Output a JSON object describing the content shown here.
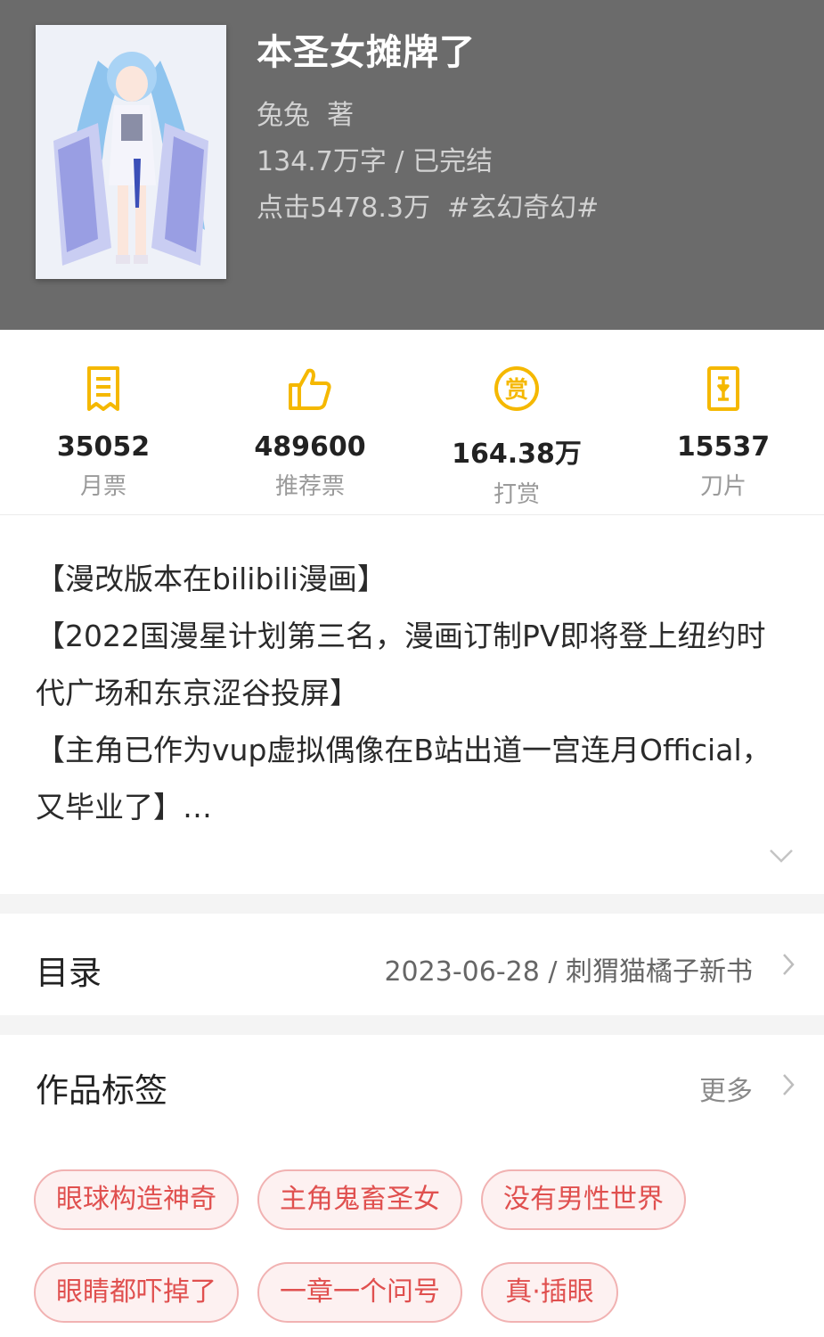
{
  "book": {
    "title": "本圣女摊牌了",
    "author_line": "兔兔  著",
    "words_line": "134.7万字 / 已完结",
    "clicks_line": "点击5478.3万  #玄幻奇幻#"
  },
  "stats": [
    {
      "icon": "monthly-ticket-icon",
      "value": "35052",
      "label": "月票"
    },
    {
      "icon": "thumbs-up-icon",
      "value": "489600",
      "label": "推荐票"
    },
    {
      "icon": "reward-coin-icon",
      "value": "164.38万",
      "label": "打赏"
    },
    {
      "icon": "blade-icon",
      "value": "15537",
      "label": "刀片"
    }
  ],
  "description": {
    "lines": [
      "【漫改版本在bilibili漫画】",
      "【2022国漫星计划第三名，漫画订制PV即将登上纽约时",
      "代广场和东京涩谷投屏】",
      "【主角已作为vup虚拟偶像在B站出道一宫连月Official，",
      "又毕业了】…"
    ]
  },
  "catalog": {
    "title": "目录",
    "latest": "2023-06-28 / 刺猬猫橘子新书"
  },
  "tags_section": {
    "title": "作品标签",
    "more": "更多",
    "tags": [
      "眼球构造神奇",
      "主角鬼畜圣女",
      "没有男性世界",
      "眼睛都吓掉了",
      "一章一个问号",
      "真·插眼"
    ]
  },
  "colors": {
    "header_bg": "#6b6b6b",
    "accent_yellow": "#f5b800",
    "tag_text": "#e0504f",
    "tag_border": "#f1b2b2",
    "tag_bg": "#fdf1f1"
  }
}
